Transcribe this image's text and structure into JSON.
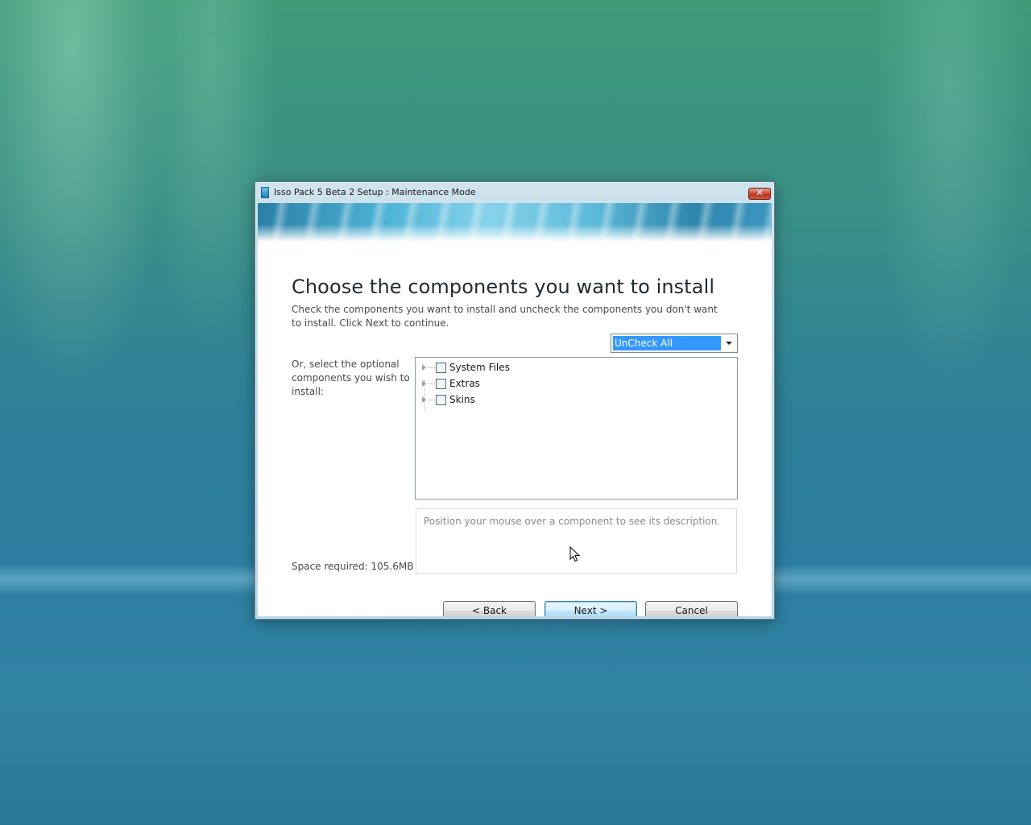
{
  "window": {
    "title": "Isso Pack 5 Beta 2 Setup : Maintenance Mode",
    "close_glyph": "✕"
  },
  "page": {
    "heading": "Choose the components you want to install",
    "subtext": "Check the components you want to install and uncheck the components you don't want to install. Click Next to continue.",
    "install_type": {
      "selected": "UnCheck All"
    },
    "optional_label": "Or, select the optional components you wish to install:",
    "components": [
      {
        "label": "System Files",
        "checked": false,
        "expandable": true
      },
      {
        "label": "Extras",
        "checked": false,
        "expandable": true
      },
      {
        "label": "Skins",
        "checked": false,
        "expandable": true
      }
    ],
    "description_placeholder": "Position your mouse over a component to see its description.",
    "space_required": "Space required: 105.6MB"
  },
  "buttons": {
    "back": "< Back",
    "next": "Next >",
    "cancel": "Cancel"
  },
  "icons": {
    "app": "installer-app-icon",
    "close": "close-icon",
    "dropdown": "chevron-down-icon",
    "expander": "tree-expander-icon",
    "cursor": "mouse-pointer-icon"
  },
  "colors": {
    "selection": "#3399ff",
    "close_button": "#d24a33"
  }
}
